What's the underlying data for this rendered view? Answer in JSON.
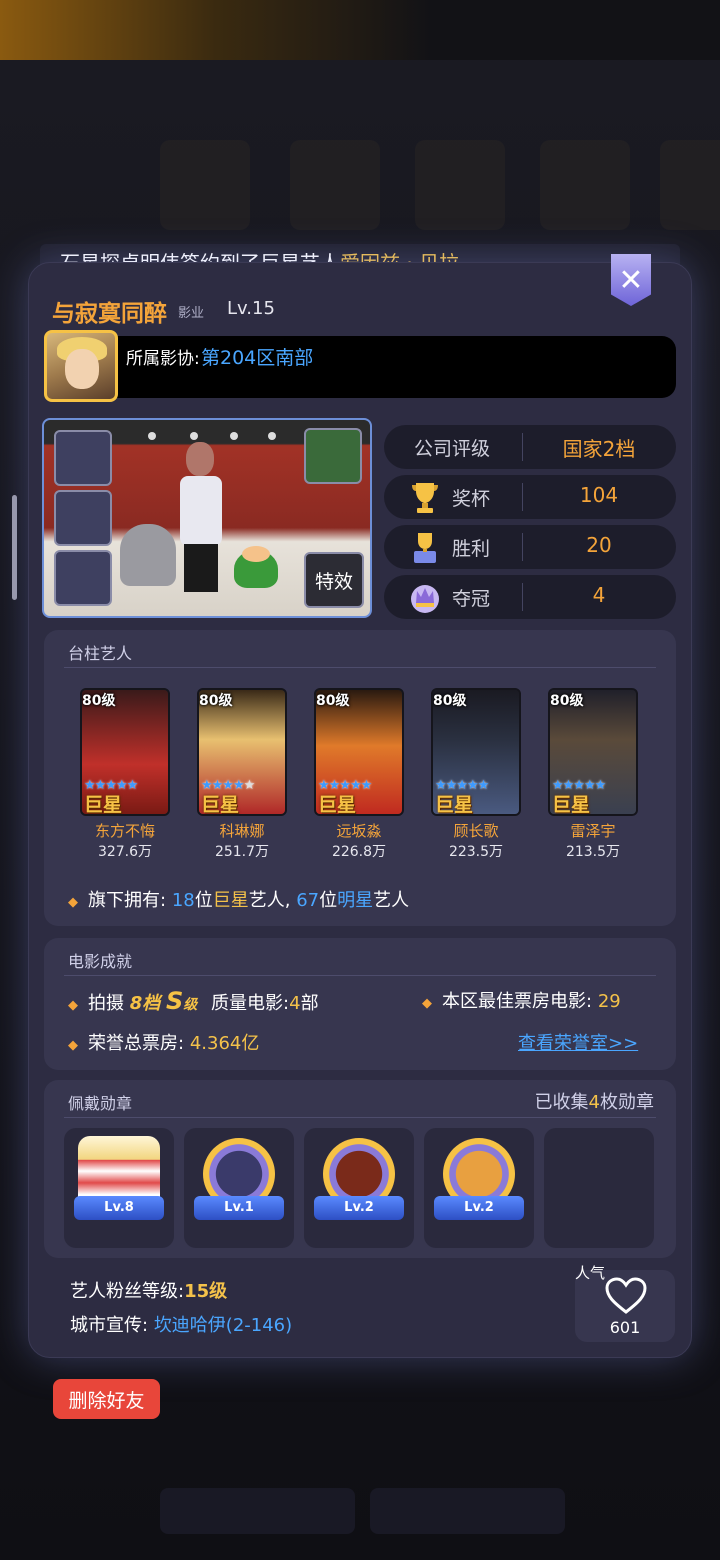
{
  "notice": {
    "prefix": "石星探卓明伟签约到了巨星艺人",
    "highlight": "爱因兹 · 贝拉"
  },
  "player": {
    "name": "与寂寞同醉",
    "tag": "影业",
    "level": "Lv.15",
    "guild_label": "所属影协:",
    "guild_value": "第204区南部"
  },
  "showroom": {
    "effect_button": "特效"
  },
  "stats": [
    {
      "label": "公司评级",
      "value": "国家2档",
      "icon": "none"
    },
    {
      "label": "奖杯",
      "value": "104",
      "icon": "trophy-icon"
    },
    {
      "label": "胜利",
      "value": "20",
      "icon": "victory-icon"
    },
    {
      "label": "夺冠",
      "value": "4",
      "icon": "crown-icon"
    }
  ],
  "pillar_artists": {
    "title": "台柱艺人",
    "artists": [
      {
        "level": "80级",
        "rank": "巨星",
        "name": "东方不悔",
        "fans": "327.6万"
      },
      {
        "level": "80级",
        "rank": "巨星",
        "name": "科琳娜",
        "fans": "251.7万"
      },
      {
        "level": "80级",
        "rank": "巨星",
        "name": "远坂淼",
        "fans": "226.8万"
      },
      {
        "level": "80级",
        "rank": "巨星",
        "name": "顾长歌",
        "fans": "223.5万"
      },
      {
        "level": "80级",
        "rank": "巨星",
        "name": "雷泽宇",
        "fans": "213.5万"
      }
    ],
    "own": {
      "prefix": "旗下拥有:",
      "superstar_count": "18",
      "unit1": "位",
      "superstar_word": "巨星",
      "middle": "艺人,",
      "star_count": "67",
      "unit2": "位",
      "star_word": "明星",
      "suffix": "艺人"
    }
  },
  "movie_achievements": {
    "title": "电影成就",
    "shoot_label": "拍摄",
    "tier": "8档",
    "grade": "S",
    "grade_suffix": "级",
    "quality_label": "质量电影:",
    "quality_count": "4",
    "quality_unit": "部",
    "best_label": "本区最佳票房电影:",
    "best_value": "29",
    "honor_label": "荣誉总票房:",
    "honor_value": "4.364亿",
    "honor_link": "查看荣誉室>>"
  },
  "medals": {
    "title": "佩戴勋章",
    "collected_prefix": "已收集",
    "collected_count": "4",
    "collected_suffix": "枚勋章",
    "items": [
      {
        "level": "Lv.8",
        "icon": "popcorn-medal-icon"
      },
      {
        "level": "Lv.1",
        "icon": "ufo-medal-icon"
      },
      {
        "level": "Lv.2",
        "icon": "silhouette-medal-icon"
      },
      {
        "level": "Lv.2",
        "icon": "soldier-medal-icon"
      },
      {
        "level": "",
        "icon": "empty-medal-slot"
      }
    ]
  },
  "footer_info": {
    "fan_label": "艺人粉丝等级:",
    "fan_value": "15级",
    "city_label": "城市宣传:",
    "city_value": "坎迪哈伊(2-146)"
  },
  "popularity": {
    "label": "人气",
    "value": "601"
  },
  "delete_button": "删除好友",
  "colors": {
    "accent_orange": "#f4a43a",
    "gold": "#f4c24a",
    "link_blue": "#4aa6ff",
    "danger_red": "#e8463a",
    "panel_bg": "#2d2c42"
  }
}
